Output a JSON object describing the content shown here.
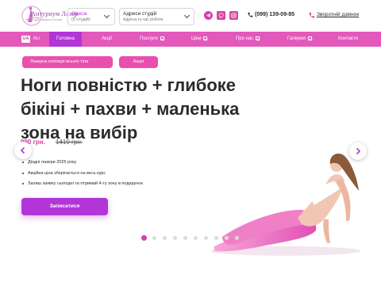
{
  "header": {
    "logo_name": "Антуриум Лазер",
    "logo_tagline": "студія лазерної епіляції",
    "city": {
      "name": "Одеса",
      "sub": "(5 студій)"
    },
    "address": {
      "title": "Адреси студій",
      "sub": "Адреса та час роботи"
    },
    "social_icons": [
      "telegram-icon",
      "viber-icon",
      "instagram-icon"
    ],
    "phone": "(099) 139-09-85",
    "callback_label": "Зворотній дзвінок"
  },
  "nav": {
    "langs": [
      "UA",
      "RU"
    ],
    "active_lang": "UA",
    "items": [
      {
        "label": "Головна",
        "active": true,
        "dropdown": false
      },
      {
        "label": "Акції",
        "active": false,
        "dropdown": false
      },
      {
        "label": "Послуги",
        "active": false,
        "dropdown": true
      },
      {
        "label": "Ціни",
        "active": false,
        "dropdown": true
      },
      {
        "label": "Про нас",
        "active": false,
        "dropdown": true
      },
      {
        "label": "Галерея",
        "active": false,
        "dropdown": true
      },
      {
        "label": "Контакти",
        "active": false,
        "dropdown": false
      }
    ]
  },
  "hero": {
    "tags": [
      "Лазерна епіляція всього тіла",
      "Акція"
    ],
    "title": "Ноги повністю + глибоке бікіні + пахви + маленька зона на вибір",
    "price_new": "990 грн.",
    "price_old": "1410 грн.",
    "bullets": [
      "Діодні лазери 2025 року",
      "Акційна ціна зберігається на весь курс",
      "Залиш заявку сьогодні та отримай 4-ту зону в подарунок"
    ],
    "cta_label": "Записатися",
    "slides_total": 10,
    "active_slide": 1
  },
  "colors": {
    "brand_pink": "#e259bb",
    "brand_purple": "#b235d8",
    "accent_magenta": "#d542a7",
    "pill_pink": "#ea4fb0"
  }
}
